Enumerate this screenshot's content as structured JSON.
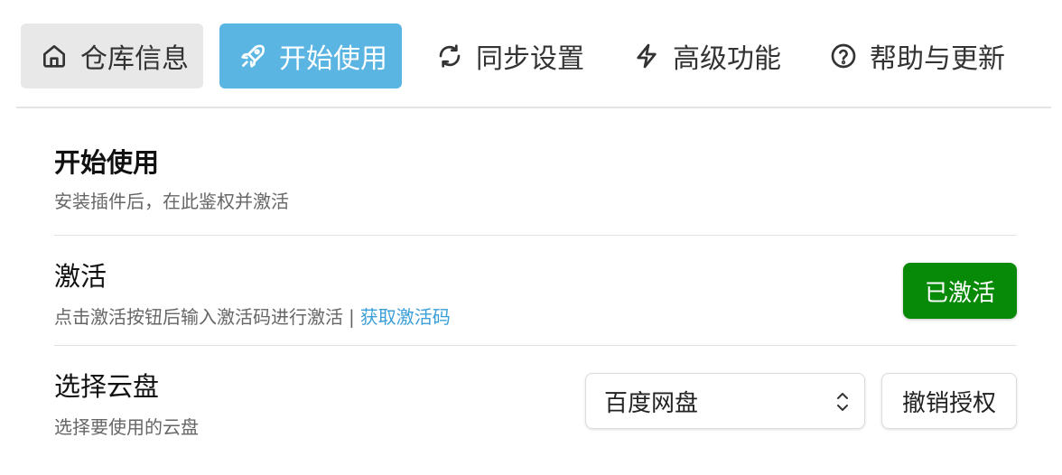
{
  "colors": {
    "tab_active_bg": "#5bb5e2",
    "activated_button_bg": "#078a07",
    "link": "#3a9fd8"
  },
  "tabs": [
    {
      "label": "仓库信息",
      "icon": "home-icon",
      "state": "hover"
    },
    {
      "label": "开始使用",
      "icon": "rocket-icon",
      "state": "active"
    },
    {
      "label": "同步设置",
      "icon": "refresh-icon",
      "state": "normal"
    },
    {
      "label": "高级功能",
      "icon": "lightning-icon",
      "state": "normal"
    },
    {
      "label": "帮助与更新",
      "icon": "help-circle-icon",
      "state": "normal"
    }
  ],
  "section": {
    "title": "开始使用",
    "description": "安装插件后，在此鉴权并激活"
  },
  "settings": {
    "activate": {
      "name": "激活",
      "description": "点击激活按钮后输入激活码进行激活",
      "separator": "|",
      "link_label": "获取激活码",
      "button_label": "已激活"
    },
    "cloud": {
      "name": "选择云盘",
      "description": "选择要使用的云盘",
      "selected_option": "百度网盘",
      "revoke_label": "撤销授权"
    }
  }
}
